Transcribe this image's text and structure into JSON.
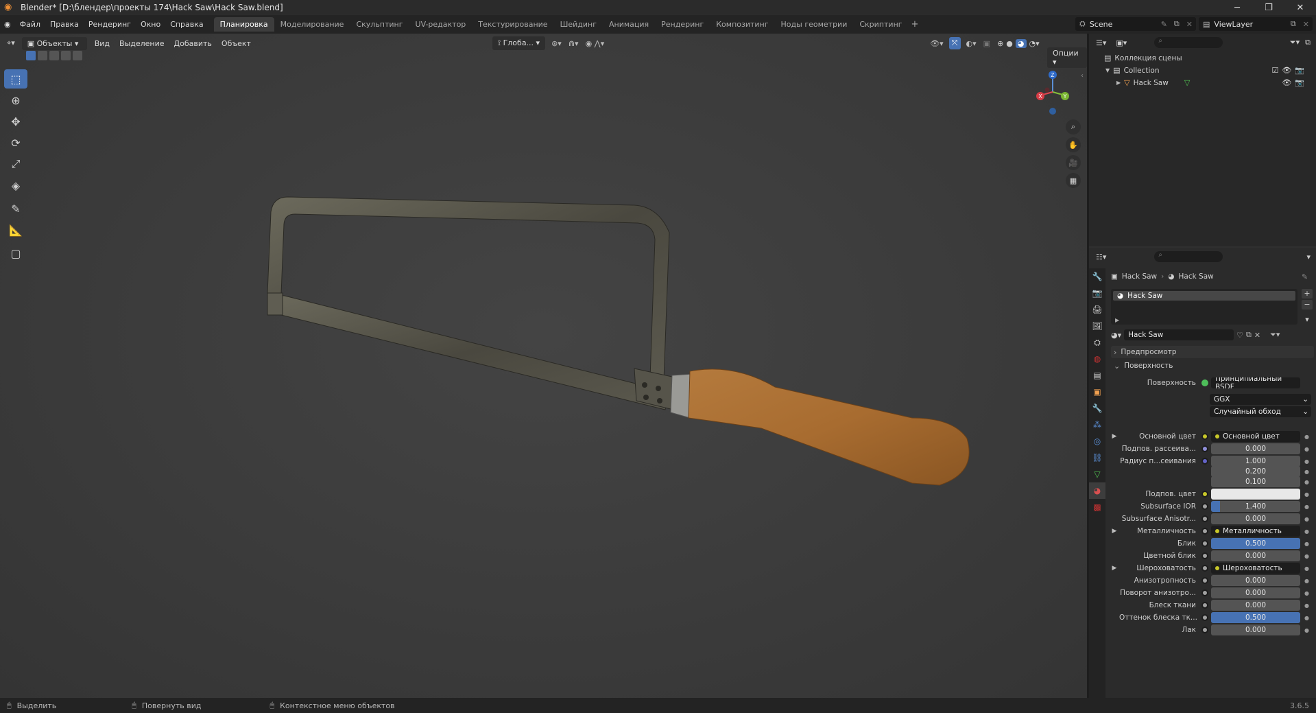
{
  "title": "Blender* [D:\\блендер\\проекты 174\\Hack Saw\\Hack Saw.blend]",
  "menu": [
    "Файл",
    "Правка",
    "Рендеринг",
    "Окно",
    "Справка"
  ],
  "workspaces": [
    "Планировка",
    "Моделирование",
    "Скульптинг",
    "UV-редактор",
    "Текстурирование",
    "Шейдинг",
    "Анимация",
    "Рендеринг",
    "Композитинг",
    "Ноды геометрии",
    "Скриптинг"
  ],
  "active_workspace": 0,
  "scene": "Scene",
  "view_layer": "ViewLayer",
  "viewport": {
    "mode": "Объекты",
    "header_menu": [
      "Вид",
      "Выделение",
      "Добавить",
      "Объект"
    ],
    "transform_orientation": "Глоба...",
    "options": "Опции"
  },
  "outliner": {
    "root": "Коллекция сцены",
    "collection": "Collection",
    "object": "Hack Saw"
  },
  "properties": {
    "breadcrumb_object": "Hack Saw",
    "breadcrumb_material": "Hack Saw",
    "slot": "Hack Saw",
    "material_name": "Hack Saw",
    "section_preview": "Предпросмотр",
    "section_surface": "Поверхность",
    "surface_label": "Поверхность",
    "surface_value": "Принципиальный BSDF",
    "distribution": "GGX",
    "subsurface_method": "Случайный обход",
    "rows": [
      {
        "label": "Основной цвет",
        "type": "link",
        "value": "Основной цвет",
        "dot": "#c7c729",
        "expand": true
      },
      {
        "label": "Подпов. рассеива...",
        "type": "num",
        "value": "0.000",
        "dot": "#8f8fd9",
        "fill": 0
      },
      {
        "label": "Радиус п...сеивания",
        "type": "num",
        "value": "1.000",
        "dot": "#6363c7",
        "fill": 0
      },
      {
        "label": "",
        "type": "num",
        "value": "0.200",
        "dot": "",
        "fill": 0
      },
      {
        "label": "",
        "type": "num",
        "value": "0.100",
        "dot": "",
        "fill": 0
      },
      {
        "label": "Подпов. цвет",
        "type": "color",
        "value": "",
        "dot": "#c7c729",
        "color": "#e8e8e8"
      },
      {
        "label": "Subsurface IOR",
        "type": "num",
        "value": "1.400",
        "dot": "#a1a1a1",
        "fill": 0.1
      },
      {
        "label": "Subsurface Anisotr...",
        "type": "num",
        "value": "0.000",
        "dot": "#a1a1a1",
        "fill": 0
      },
      {
        "label": "Металличность",
        "type": "link",
        "value": "Металличность",
        "dot": "#a1a1a1",
        "expand": true
      },
      {
        "label": "Блик",
        "type": "num",
        "value": "0.500",
        "dot": "#a1a1a1",
        "fill": 1
      },
      {
        "label": "Цветной блик",
        "type": "num",
        "value": "0.000",
        "dot": "#a1a1a1",
        "fill": 0
      },
      {
        "label": "Шероховатость",
        "type": "link",
        "value": "Шероховатость",
        "dot": "#a1a1a1",
        "expand": true
      },
      {
        "label": "Анизотропность",
        "type": "num",
        "value": "0.000",
        "dot": "#a1a1a1",
        "fill": 0
      },
      {
        "label": "Поворот анизотро...",
        "type": "num",
        "value": "0.000",
        "dot": "#a1a1a1",
        "fill": 0
      },
      {
        "label": "Блеск ткани",
        "type": "num",
        "value": "0.000",
        "dot": "#a1a1a1",
        "fill": 0
      },
      {
        "label": "Оттенок блеска тк...",
        "type": "num",
        "value": "0.500",
        "dot": "#a1a1a1",
        "fill": 1
      },
      {
        "label": "Лак",
        "type": "num",
        "value": "0.000",
        "dot": "#a1a1a1",
        "fill": 0
      }
    ]
  },
  "status": {
    "select": "Выделить",
    "rotate": "Повернуть вид",
    "context": "Контекстное меню объектов",
    "version": "3.6.5"
  },
  "colors": {
    "accent": "#4772b3",
    "header": "#303030",
    "viewport": "#3d3d3d"
  }
}
